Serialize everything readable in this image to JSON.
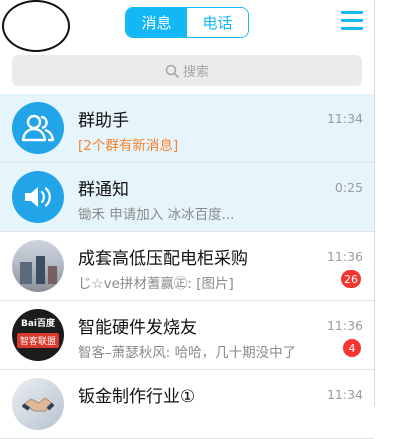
{
  "header": {
    "tabs": [
      {
        "label": "消息",
        "active": true
      },
      {
        "label": "电话",
        "active": false
      }
    ],
    "menu_icon": "hamburger-menu-icon"
  },
  "search": {
    "placeholder": "搜索",
    "icon": "search-icon"
  },
  "conversations": [
    {
      "title": "群助手",
      "subtitle": "[2个群有新消息]",
      "time": "11:34",
      "badge": null,
      "avatar": "group-assistant-icon"
    },
    {
      "title": "群通知",
      "subtitle": "锄禾 申请加入 冰冰百度...",
      "time": "0:25",
      "badge": null,
      "avatar": "speaker-icon"
    },
    {
      "title": "成套高低压配电柜采购",
      "subtitle": "じ☆ve拼材蓍赢㊣: [图片]",
      "time": "11:36",
      "badge": "26",
      "avatar": "group-photo-avatar"
    },
    {
      "title": "智能硬件发烧友",
      "subtitle": "智客–萧瑟秋风: 哈哈，几十期没中了",
      "time": "11:36",
      "badge": "4",
      "avatar": "group-logo-avatar",
      "avatar_text": [
        "Bai百度",
        "智客联盟"
      ]
    },
    {
      "title": "钣金制作行业①",
      "subtitle": "",
      "time": "11:34",
      "badge": null,
      "avatar": "handshake-avatar"
    }
  ],
  "colors": {
    "accent": "#12b7f5",
    "pinned_bg": "#e6f5fb",
    "badge": "#f43530",
    "highlight_text": "#f5832a"
  }
}
